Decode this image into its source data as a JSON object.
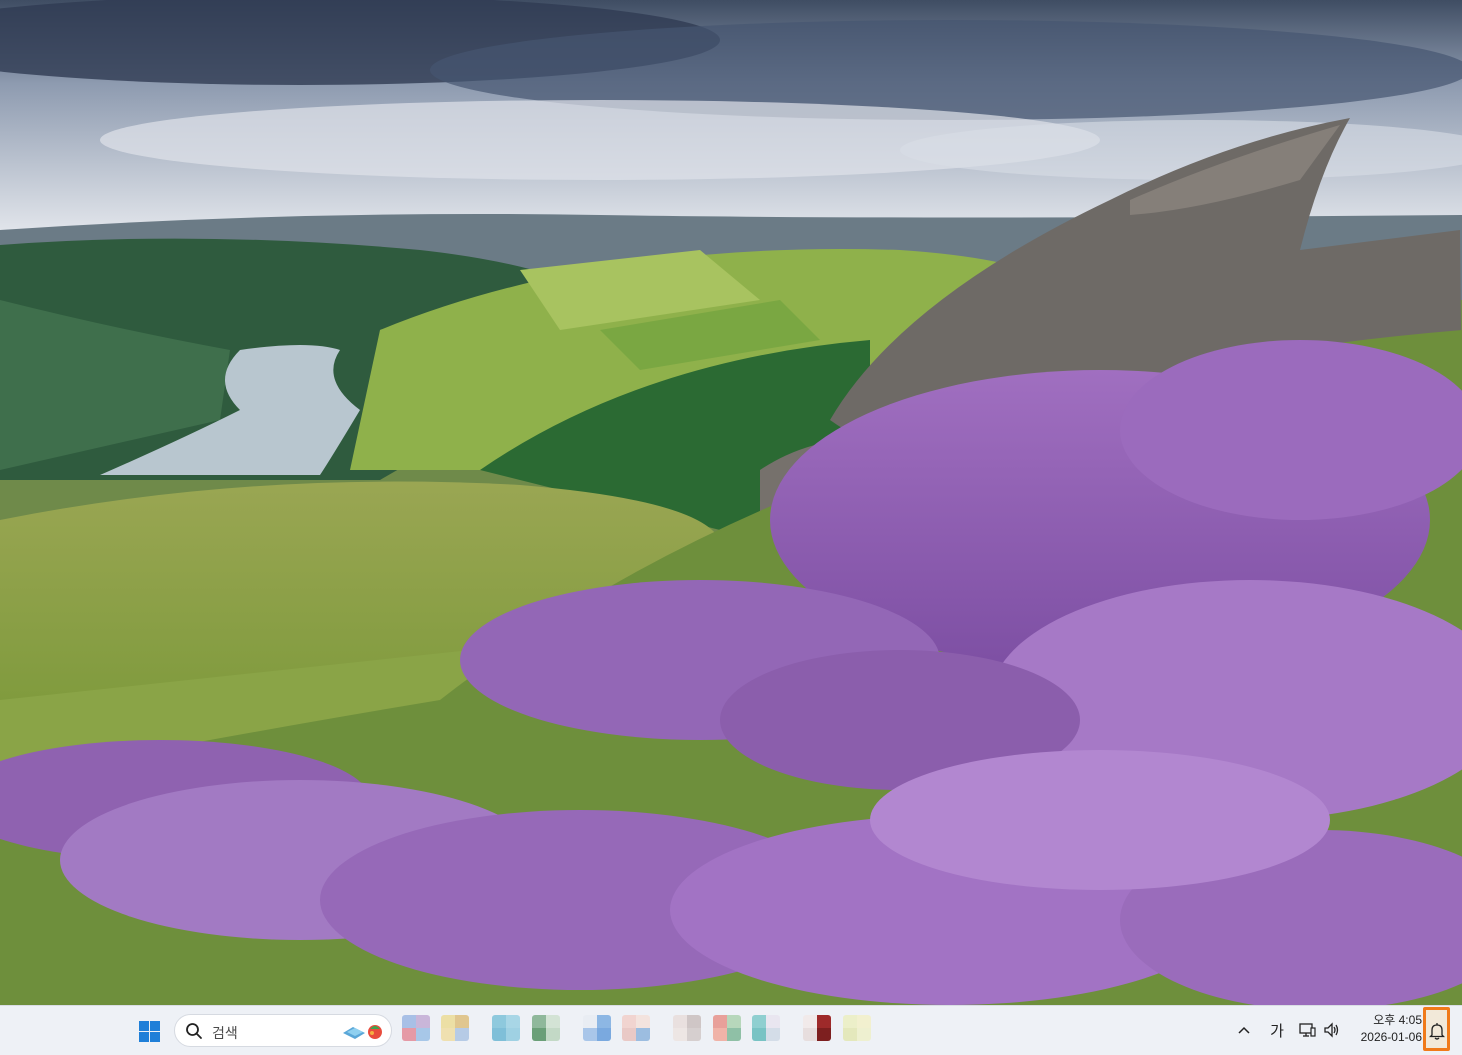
{
  "desktop": {
    "wallpaper": "landscape with purple heather, rocky outcrop, reservoir and green hills"
  },
  "taskbar": {
    "start_icon": "windows-start-icon",
    "search": {
      "icon": "search-icon",
      "label": "검색",
      "widget_icon": "search-highlight-icon"
    },
    "apps": [
      {
        "name": "app-1",
        "colors": [
          "#a8c0e6",
          "#c9b6d9",
          "#e59aa6",
          "#a7c7e8"
        ]
      },
      {
        "name": "app-2",
        "colors": [
          "#ecdfa5",
          "#e0c68f",
          "#efe0b0",
          "#b6cbe6"
        ]
      },
      {
        "name": "app-3",
        "colors": [
          "#8ec9dd",
          "#a8d6e6",
          "#7fbfd8",
          "#9fd1e3"
        ]
      },
      {
        "name": "app-4",
        "colors": [
          "#8fb89b",
          "#d3e3d5",
          "#6a9f78",
          "#c3d9c6"
        ]
      },
      {
        "name": "app-5",
        "colors": [
          "#e9edf3",
          "#8db7e4",
          "#a9c6e9",
          "#7aa9df"
        ]
      },
      {
        "name": "app-6",
        "colors": [
          "#f1d4d0",
          "#f3e3de",
          "#e9c9c6",
          "#9cbde0"
        ]
      },
      {
        "name": "app-7",
        "colors": [
          "#e9e0df",
          "#cfc6c6",
          "#ede6e4",
          "#d6cfcf"
        ]
      },
      {
        "name": "app-8",
        "colors": [
          "#e8a09a",
          "#b7d7bb",
          "#f0b3a8",
          "#8fc0a6"
        ]
      },
      {
        "name": "app-9",
        "colors": [
          "#8fcfd0",
          "#e9e6f0",
          "#78c3c4",
          "#d4dde8"
        ]
      },
      {
        "name": "app-10",
        "colors": [
          "#f1eaea",
          "#9e2a2a",
          "#e7dede",
          "#7d1f1f"
        ]
      },
      {
        "name": "app-11",
        "colors": [
          "#ecefc9",
          "#f2f0cf",
          "#e4e8bc",
          "#eef0d0"
        ]
      }
    ],
    "tray": {
      "chevron_icon": "chevron-up-icon",
      "ime_label": "가",
      "network_icon": "network-icon",
      "volume_icon": "volume-icon",
      "time": "오후 4:05",
      "date": "2026-01-06",
      "notification_icon": "notification-bell-icon",
      "highlight_color": "#f07a1a"
    }
  }
}
